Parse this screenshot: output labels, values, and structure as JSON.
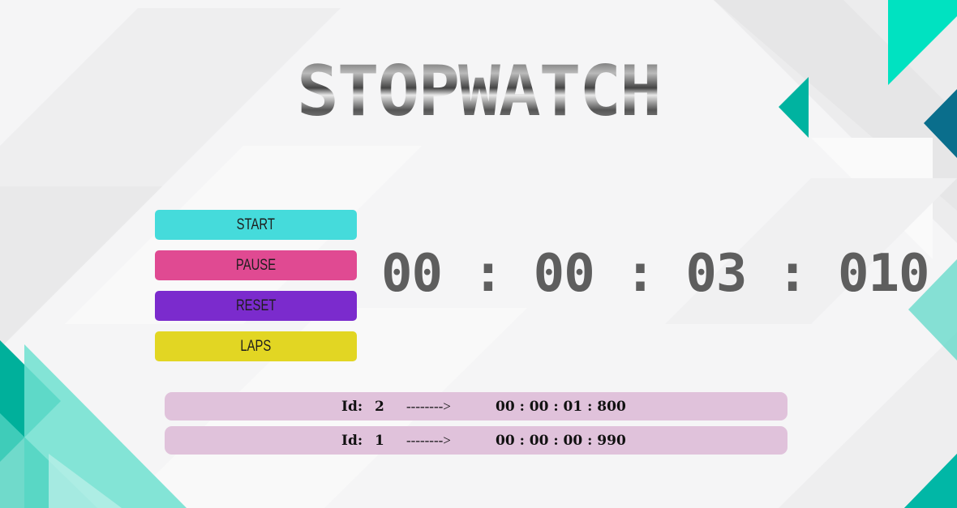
{
  "title": "STOPWATCH",
  "buttons": {
    "start": "START",
    "pause": "PAUSE",
    "reset": "RESET",
    "laps": "LAPS"
  },
  "timer": {
    "display": "00 : 00 : 03 : 010"
  },
  "laps": [
    {
      "label": "Id:",
      "id": "2",
      "arrow": "-------->",
      "time": "00 : 00 : 01 : 800"
    },
    {
      "label": "Id:",
      "id": "1",
      "arrow": "-------->",
      "time": "00 : 00 : 00 : 990"
    }
  ],
  "colors": {
    "start": "#45dbdb",
    "pause": "#e04a92",
    "reset": "#7b2bcd",
    "laps": "#e2d623",
    "lap_row": "#e0c2db",
    "timer_text": "#5e5e5e",
    "accent_teal": "#00b7a1"
  }
}
